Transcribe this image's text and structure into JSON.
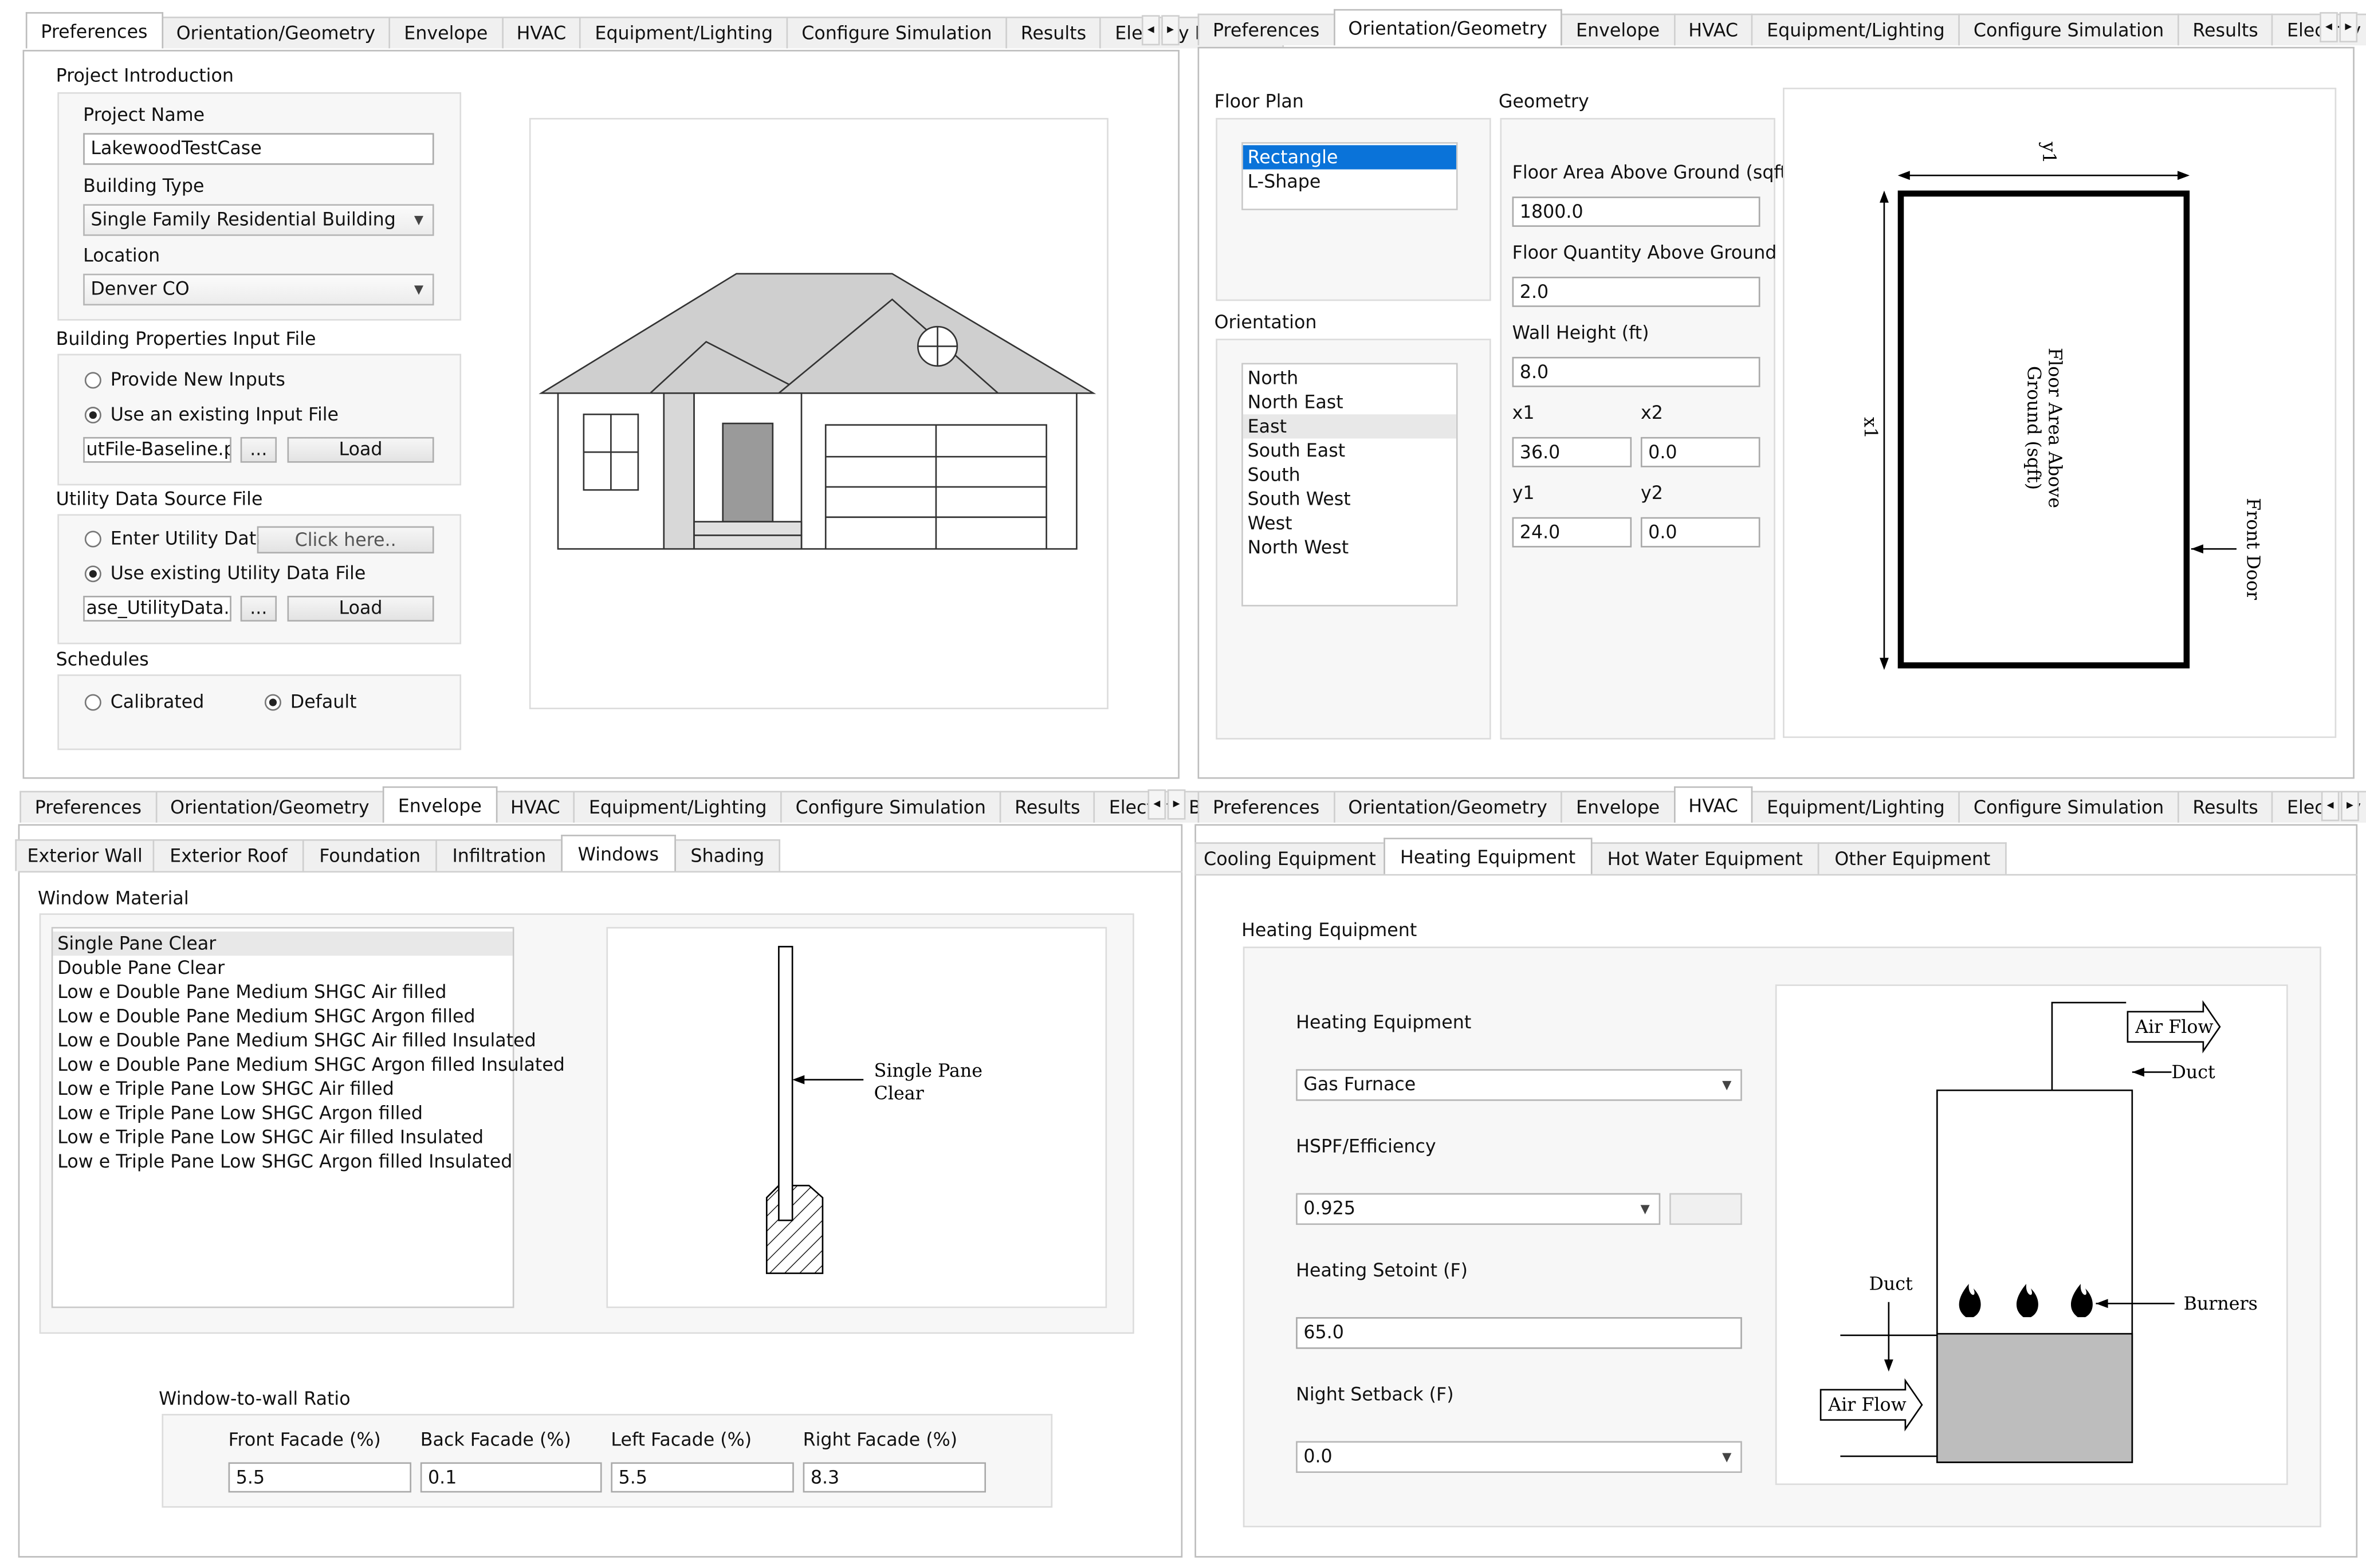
{
  "tabs": [
    "Preferences",
    "Orientation/Geometry",
    "Envelope",
    "HVAC",
    "Equipment/Lighting",
    "Configure Simulation",
    "Results",
    "Electrify Building"
  ],
  "nav": {
    "prev": "◂",
    "next": "▸"
  },
  "pref": {
    "section_intro": "Project Introduction",
    "project_name_label": "Project Name",
    "project_name": "LakewoodTestCase",
    "building_type_label": "Building Type",
    "building_type": "Single Family Residential Building",
    "location_label": "Location",
    "location": "Denver CO",
    "section_props": "Building Properties Input File",
    "radio_new": "Provide New Inputs",
    "radio_existing": "Use an existing Input File",
    "input_file": "utFile-Baseline.pkl",
    "browse": "...",
    "load": "Load",
    "section_utility": "Utility Data Source File",
    "radio_enter_utility": "Enter Utility Data",
    "click_here": "Click here..",
    "radio_existing_utility": "Use existing Utility Data File",
    "utility_file": "ase_UtilityData.csv",
    "section_schedules": "Schedules",
    "radio_calibrated": "Calibrated",
    "radio_default": "Default"
  },
  "geom": {
    "floor_plan_label": "Floor Plan",
    "floor_plans": [
      "Rectangle",
      "L-Shape"
    ],
    "orientation_label": "Orientation",
    "orientations": [
      "North",
      "North East",
      "East",
      "South East",
      "South",
      "South West",
      "West",
      "North West"
    ],
    "geometry_label": "Geometry",
    "floor_area_label": "Floor Area Above Ground (sqft)",
    "floor_area": "1800.0",
    "floor_qty_label": "Floor Quantity Above Ground",
    "floor_qty": "2.0",
    "wall_height_label": "Wall Height (ft)",
    "wall_height": "8.0",
    "x1_label": "x1",
    "x1": "36.0",
    "x2_label": "x2",
    "x2": "0.0",
    "y1_label": "y1",
    "y1": "24.0",
    "y2_label": "y2",
    "y2": "0.0",
    "diagram_y1": "y1",
    "diagram_x1": "x1",
    "diagram_area_line1": "Floor Area Above",
    "diagram_area_line2": "Ground (sqft)",
    "diagram_front_door": "Front Door"
  },
  "env": {
    "subtabs": [
      "Exterior Wall",
      "Exterior Roof",
      "Foundation",
      "Infiltration",
      "Windows",
      "Shading"
    ],
    "window_material_label": "Window Material",
    "materials": [
      "Single Pane Clear",
      "Double Pane Clear",
      "Low e Double Pane Medium SHGC Air filled",
      "Low e Double Pane Medium SHGC Argon filled",
      "Low e Double Pane Medium SHGC Air filled Insulated",
      "Low e Double Pane Medium SHGC Argon filled Insulated",
      "Low e Triple Pane Low SHGC Air filled",
      "Low e Triple Pane Low SHGC Argon filled",
      "Low e Triple Pane Low SHGC Air filled Insulated",
      "Low e Triple Pane Low SHGC Argon filled Insulated"
    ],
    "diagram_line1": "Single Pane",
    "diagram_line2": "Clear",
    "wwr_label": "Window-to-wall Ratio",
    "front_label": "Front Facade (%)",
    "front": "5.5",
    "back_label": "Back Facade (%)",
    "back": "0.1",
    "left_label": "Left Facade (%)",
    "left": "5.5",
    "right_label": "Right Facade (%)",
    "right": "8.3"
  },
  "hvac": {
    "subtabs": [
      "Cooling Equipment",
      "Heating Equipment",
      "Hot Water Equipment",
      "Other Equipment"
    ],
    "section_label": "Heating Equipment",
    "equip_label": "Heating Equipment",
    "equip": "Gas Furnace",
    "eff_label": "HSPF/Efficiency",
    "eff": "0.925",
    "setpoint_label": "Heating Setoint (F)",
    "setpoint": "65.0",
    "setback_label": "Night Setback (F)",
    "setback": "0.0",
    "diagram_airflow_top": "Air Flow",
    "diagram_duct_top": "Duct",
    "diagram_duct_left": "Duct",
    "diagram_burners": "Burners",
    "diagram_airflow_left": "Air Flow"
  }
}
